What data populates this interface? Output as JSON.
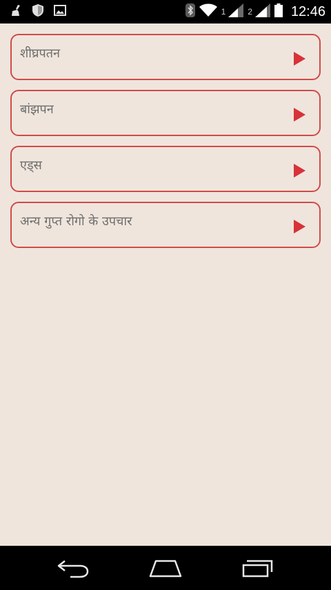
{
  "status_bar": {
    "time": "12:46",
    "sim1": "1",
    "sim2": "2",
    "icons": [
      "broom-icon",
      "shield-icon",
      "image-icon",
      "bluetooth-icon",
      "wifi-icon",
      "signal-icon",
      "battery-icon"
    ]
  },
  "menu": {
    "items": [
      {
        "label": "शीघ्रपतन"
      },
      {
        "label": "बांझपन"
      },
      {
        "label": "एड्स"
      },
      {
        "label": "अन्य गुप्त रोगो के उपचार"
      }
    ]
  },
  "colors": {
    "background": "#efe5dc",
    "accent": "#d8323a",
    "border": "#d04a4a",
    "text": "#6e6e6e"
  },
  "nav_bar": {
    "icons": [
      "back-icon",
      "home-icon",
      "recent-apps-icon"
    ]
  }
}
